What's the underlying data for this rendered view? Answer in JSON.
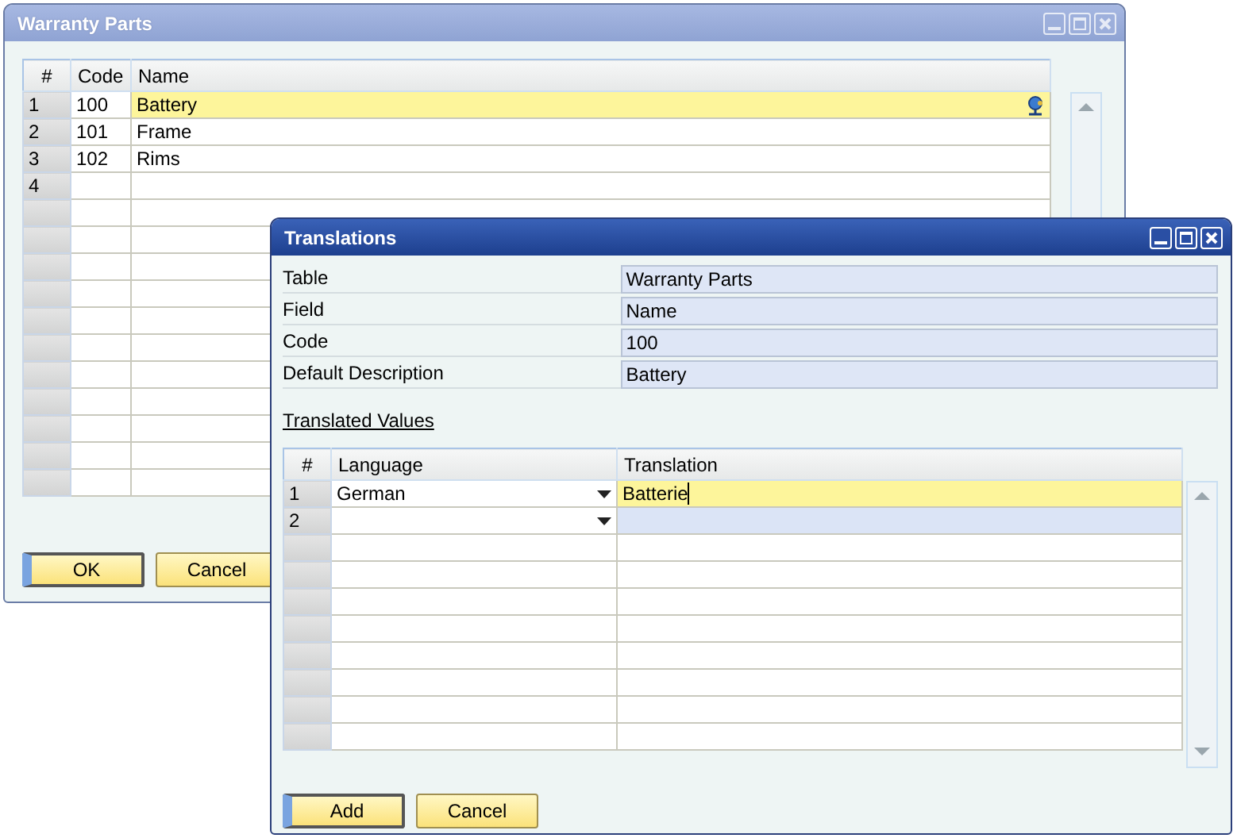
{
  "windows": [
    {
      "title": "Warranty Parts",
      "active": false,
      "grid": {
        "columns": [
          "#",
          "Code",
          "Name"
        ],
        "rows": [
          {
            "number": "1",
            "code": "100",
            "name": "Battery",
            "selected": true
          },
          {
            "number": "2",
            "code": "101",
            "name": "Frame",
            "selected": false
          },
          {
            "number": "3",
            "code": "102",
            "name": "Rims",
            "selected": false
          },
          {
            "number": "4",
            "selected": false
          },
          {
            "selected": false
          },
          {
            "selected": false
          },
          {
            "selected": false
          },
          {
            "selected": false
          },
          {
            "selected": false
          },
          {
            "selected": false
          },
          {
            "selected": false
          },
          {
            "selected": false
          },
          {
            "selected": false
          },
          {
            "selected": false
          },
          {
            "selected": false
          }
        ]
      },
      "buttons": [
        {
          "label": "OK",
          "default": true
        },
        {
          "label": "Cancel",
          "default": false
        }
      ]
    },
    {
      "title": "Translations",
      "active": true,
      "fields": [
        {
          "label": "Table",
          "value": "Warranty Parts"
        },
        {
          "label": "Field",
          "value": "Name"
        },
        {
          "label": "Code",
          "value": "100"
        },
        {
          "label": "Default Description",
          "value": "Battery"
        }
      ],
      "section_link": "Translated Values",
      "grid": {
        "columns": [
          "#",
          "Language",
          "Translation"
        ],
        "rows": [
          {
            "number": "1",
            "language": "German",
            "translation": "Batterie",
            "selected": true,
            "new": false
          },
          {
            "number": "2",
            "selected": false,
            "new": true
          },
          {
            "selected": false,
            "new": false
          },
          {
            "selected": false,
            "new": false
          },
          {
            "selected": false,
            "new": false
          },
          {
            "selected": false,
            "new": false
          },
          {
            "selected": false,
            "new": false
          },
          {
            "selected": false,
            "new": false
          },
          {
            "selected": false,
            "new": false
          },
          {
            "selected": false,
            "new": false
          }
        ]
      },
      "buttons": [
        {
          "label": "Add",
          "default": true
        },
        {
          "label": "Cancel",
          "default": false
        }
      ]
    }
  ]
}
